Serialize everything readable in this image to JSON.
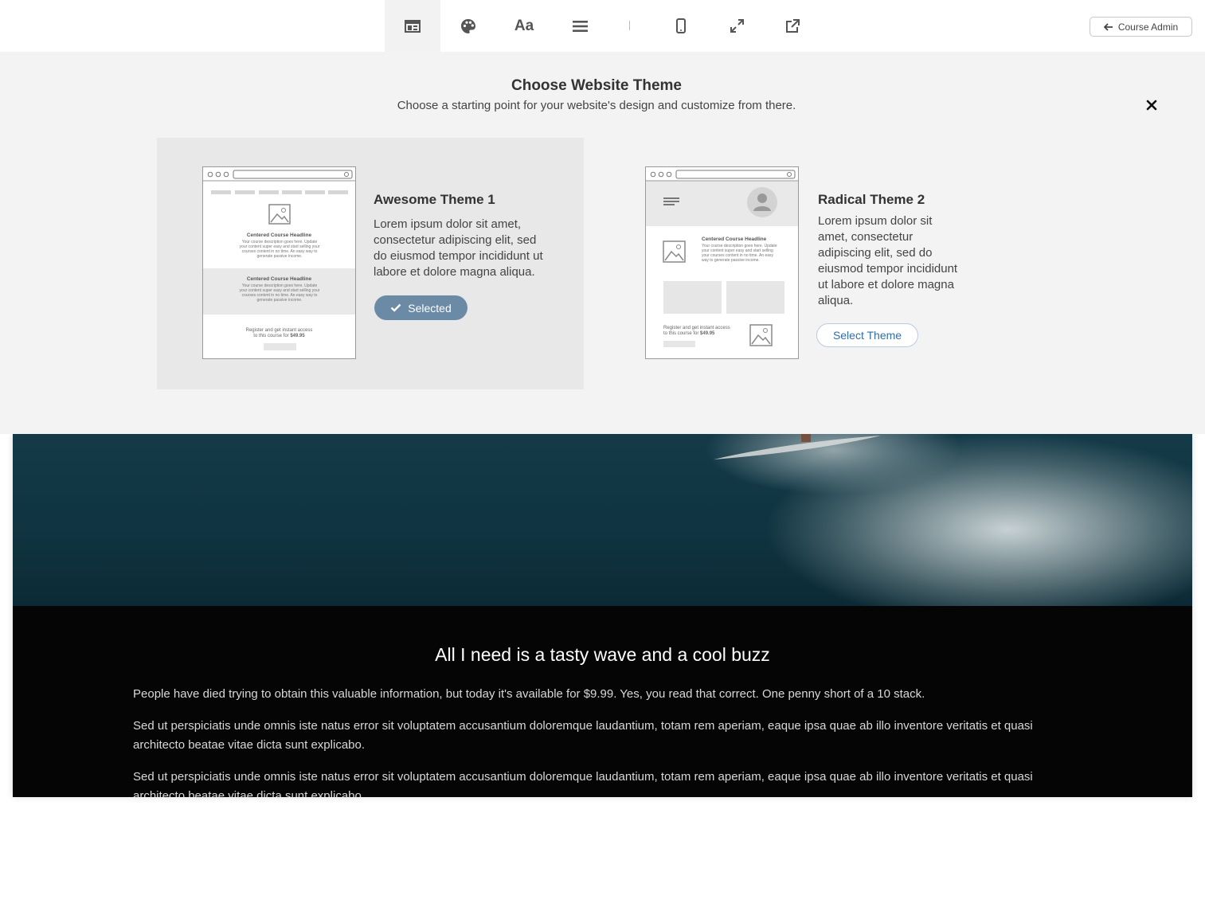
{
  "toolbar": {
    "tools": [
      {
        "name": "layout",
        "icon": "layout-icon",
        "active": true
      },
      {
        "name": "colors",
        "icon": "palette-icon"
      },
      {
        "name": "fonts",
        "icon": "font-icon",
        "glyph": "Aa"
      },
      {
        "name": "sections",
        "icon": "menu-lines-icon"
      },
      {
        "name": "mobile",
        "icon": "mobile-icon"
      },
      {
        "name": "fullscreen",
        "icon": "expand-icon"
      },
      {
        "name": "open-external",
        "icon": "external-link-icon"
      }
    ],
    "admin_label": "Course Admin"
  },
  "panel": {
    "title": "Choose Website Theme",
    "subtitle": "Choose a starting point for your website's design and customize from there.",
    "themes": [
      {
        "name": "Awesome Theme 1",
        "description": "Lorem ipsum dolor sit amet, consectetur adipiscing elit, sed do eiusmod tempor incididunt ut labore et dolore magna aliqua.",
        "button_label": "Selected",
        "selected": true,
        "mock": {
          "headline": "Centered Course Headline",
          "body": "Your course description goes here. Update your content super easy and start selling your courses content in no time. An easy way to generate passive income.",
          "cta_line1": "Register and get instant access",
          "cta_line2": "to this course for",
          "price": "$49.95"
        }
      },
      {
        "name": "Radical Theme 2",
        "description": "Lorem ipsum dolor sit amet, consectetur adipiscing elit, sed do eiusmod tempor incididunt ut labore et dolore magna aliqua.",
        "button_label": "Select Theme",
        "selected": false,
        "mock": {
          "headline": "Centered Course Headline",
          "body": "Your course description goes here. Update your content super easy and start selling your courses content in no time. An easy way to generate passive income.",
          "cta_line1": "Register and get instant access",
          "cta_line2": "to this course for",
          "price": "$49.95"
        }
      }
    ]
  },
  "preview": {
    "heading": "All I need is a tasty wave and a cool buzz",
    "paragraphs": [
      "People have died trying to obtain this valuable information, but today it's available for $9.99. Yes, you read that correct. One penny short of a 10 stack.",
      "Sed ut perspiciatis unde omnis iste natus error sit voluptatem accusantium doloremque laudantium, totam rem aperiam, eaque ipsa quae ab illo inventore veritatis et quasi architecto beatae vitae dicta sunt explicabo.",
      "Sed ut perspiciatis unde omnis iste natus error sit voluptatem accusantium doloremque laudantium, totam rem aperiam, eaque ipsa quae ab illo inventore veritatis et quasi architecto beatae vitae dicta sunt explicabo."
    ]
  },
  "colors": {
    "selected_button": "#6a8aa6",
    "select_button_text": "#2f6fa8",
    "panel_bg": "#f3f3f3",
    "selected_card_bg": "#e8e8e8"
  }
}
